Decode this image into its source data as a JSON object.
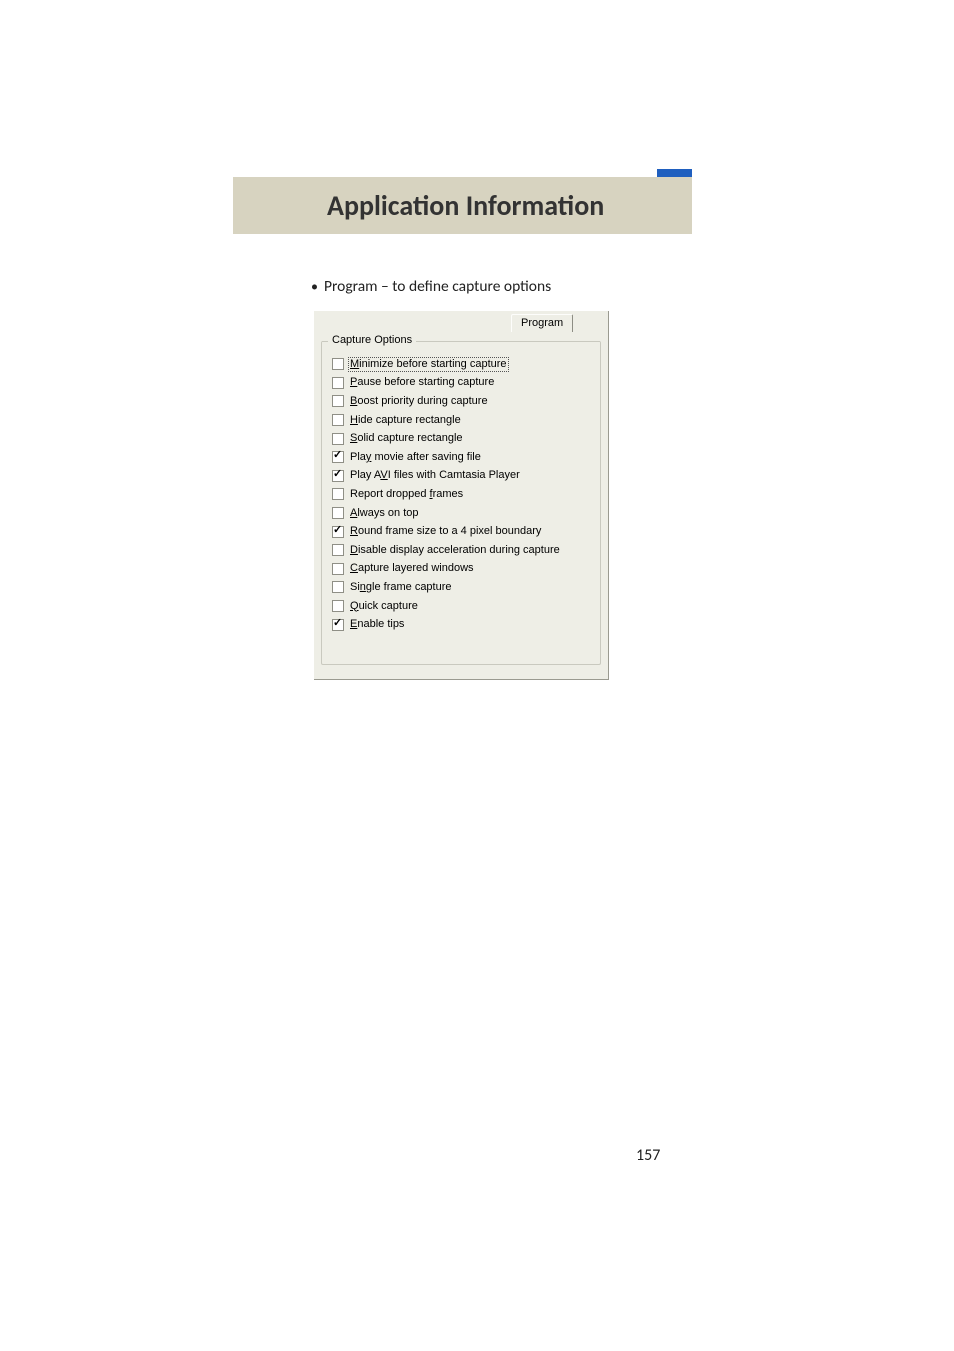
{
  "header": {
    "title": "Application Information"
  },
  "bullet": {
    "text": "Program – to define capture options"
  },
  "dialog": {
    "tab_label": "Program",
    "group_legend": "Capture Options",
    "options": [
      {
        "checked": false,
        "focused": true,
        "pre": "",
        "accel": "M",
        "post": "inimize before starting capture"
      },
      {
        "checked": false,
        "focused": false,
        "pre": "",
        "accel": "P",
        "post": "ause before starting capture"
      },
      {
        "checked": false,
        "focused": false,
        "pre": "",
        "accel": "B",
        "post": "oost priority during capture"
      },
      {
        "checked": false,
        "focused": false,
        "pre": "",
        "accel": "H",
        "post": "ide capture rectangle"
      },
      {
        "checked": false,
        "focused": false,
        "pre": "",
        "accel": "S",
        "post": "olid capture rectangle"
      },
      {
        "checked": true,
        "focused": false,
        "pre": "Pla",
        "accel": "y",
        "post": " movie after saving file"
      },
      {
        "checked": true,
        "focused": false,
        "pre": "Play A",
        "accel": "V",
        "post": "I files with Camtasia Player"
      },
      {
        "checked": false,
        "focused": false,
        "pre": "Report dropped ",
        "accel": "f",
        "post": "rames"
      },
      {
        "checked": false,
        "focused": false,
        "pre": "",
        "accel": "A",
        "post": "lways on top"
      },
      {
        "checked": true,
        "focused": false,
        "pre": "",
        "accel": "R",
        "post": "ound frame size to a 4 pixel boundary"
      },
      {
        "checked": false,
        "focused": false,
        "pre": "",
        "accel": "D",
        "post": "isable display acceleration during capture"
      },
      {
        "checked": false,
        "focused": false,
        "pre": "",
        "accel": "C",
        "post": "apture layered windows"
      },
      {
        "checked": false,
        "focused": false,
        "pre": "Si",
        "accel": "n",
        "post": "gle frame capture"
      },
      {
        "checked": false,
        "focused": false,
        "pre": "",
        "accel": "Q",
        "post": "uick capture"
      },
      {
        "checked": true,
        "focused": false,
        "pre": "",
        "accel": "E",
        "post": "nable tips"
      }
    ]
  },
  "page_number": "157"
}
